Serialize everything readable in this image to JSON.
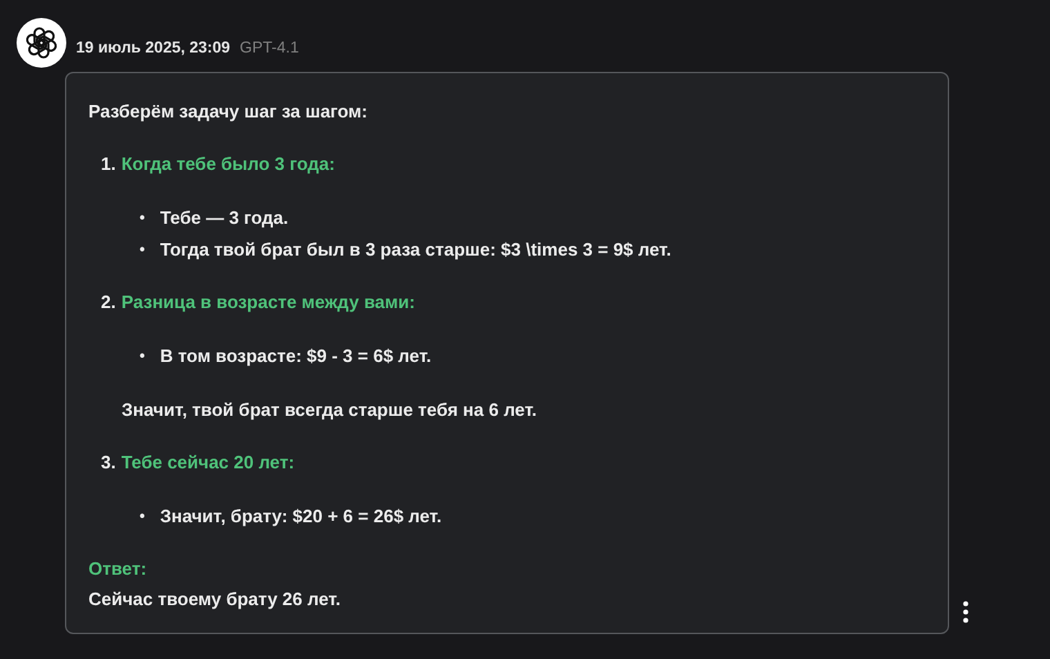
{
  "message": {
    "date": "19 июль 2025, 23:09",
    "model": "GPT-4.1",
    "intro": "Разберём задачу шаг за шагом:",
    "steps": [
      {
        "number": "1.",
        "title": "Когда тебе было 3 года:",
        "bullets": [
          "Тебе — 3 года.",
          "Тогда твой брат был в 3 раза старше: $3 \\times 3 = 9$ лет."
        ]
      },
      {
        "number": "2.",
        "title": "Разница в возрасте между вами:",
        "bullets": [
          "В том возрасте: $9 - 3 = 6$ лет."
        ],
        "note": "Значит, твой брат всегда старше тебя на 6 лет."
      },
      {
        "number": "3.",
        "title": "Тебе сейчас 20 лет:",
        "bullets": [
          "Значит, брату: $20 + 6 = 26$ лет."
        ]
      }
    ],
    "answer_label": "Ответ:",
    "answer": "Сейчас твоему брату 26 лет.",
    "bullet_mark": "•"
  }
}
